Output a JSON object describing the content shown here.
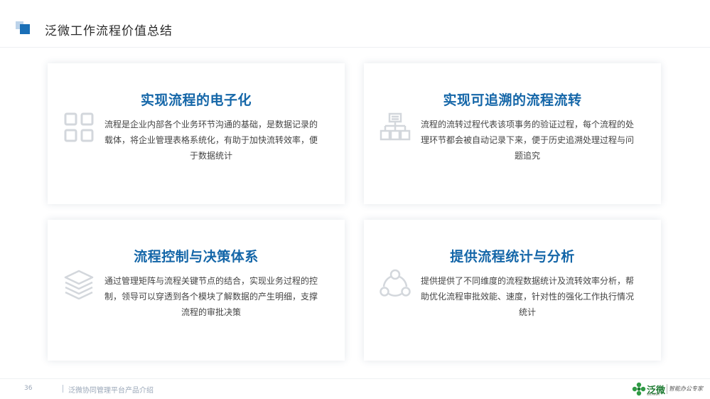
{
  "header": {
    "title": "泛微工作流程价值总结"
  },
  "cards": [
    {
      "title": "实现流程的电子化",
      "icon": "grid-icon",
      "text": "流程是企业内部各个业务环节沟通的基础，是数据记录的载体，将企业管理表格系统化，有助于加快流转效率，便于数据统计"
    },
    {
      "title": "实现可追溯的流程流转",
      "icon": "org-chart-icon",
      "text": "流程的流转过程代表该项事务的验证过程，每个流程的处理环节都会被自动记录下来，便于历史追溯处理过程与问题追究"
    },
    {
      "title": "流程控制与决策体系",
      "icon": "layers-icon",
      "text": "通过管理矩阵与流程关键节点的结合，实现业务过程的控制，领导可以穿透到各个模块了解数据的产生明细，支撑流程的审批决策"
    },
    {
      "title": "提供流程统计与分析",
      "icon": "network-nodes-icon",
      "text": "提供提供了不同维度的流程数据统计及流转效率分析，帮助优化流程审批效能、速度，针对性的强化工作执行情况统计"
    }
  ],
  "footer": {
    "page_number": "36",
    "text": "泛微协同管理平台产品介绍",
    "logo_text": "泛微",
    "logo_sub": "WEAVER",
    "slogan": "智能办公专家"
  },
  "colors": {
    "accent": "#1466a8",
    "header_mark": "#1a6fb7",
    "icon_gray": "#d3d7dc",
    "logo_green": "#1e7b32"
  }
}
